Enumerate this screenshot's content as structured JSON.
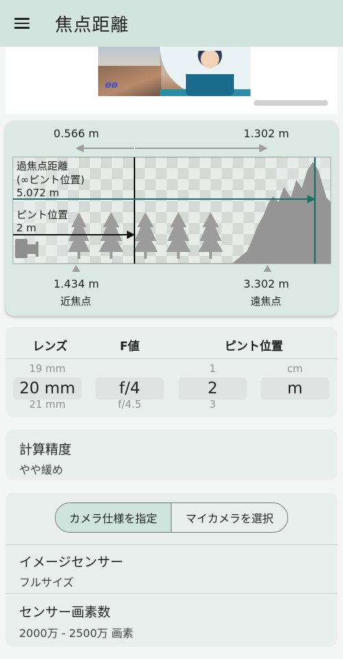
{
  "app_bar": {
    "title": "焦点距離",
    "menu_icon": "hamburger-menu-icon"
  },
  "ad": {
    "logo_text": "ΘΘ"
  },
  "dof": {
    "dof_near_label": "0.566 m",
    "dof_far_label": "1.302 m",
    "hyperfocal_title_line1": "過焦点距離",
    "hyperfocal_title_line2": "(∞ピント位置)",
    "hyperfocal_value": "5.072 m",
    "focus_title": "ピント位置",
    "focus_value": "2 m",
    "near_point_value": "1.434 m",
    "near_point_label": "近焦点",
    "far_point_value": "3.302 m",
    "far_point_label": "遠焦点",
    "colors": {
      "teal": "#1f6e63",
      "arrow_gray": "#9a9f9d",
      "tree_gray": "#9c9c9c",
      "black": "#111111"
    }
  },
  "picker": {
    "headers": {
      "lens": "レンズ",
      "fnum": "F値",
      "focus": "ピント位置"
    },
    "lens": {
      "prev": "19 mm",
      "selected": "20 mm",
      "next": "21 mm"
    },
    "fnum": {
      "prev": "",
      "selected": "f/4",
      "next": "f/4.5"
    },
    "focus": {
      "prev": "1",
      "selected": "2",
      "next": "3"
    },
    "unit": {
      "prev": "cm",
      "selected": "m",
      "next": ""
    }
  },
  "precision": {
    "title": "計算精度",
    "value": "やや緩め"
  },
  "camera": {
    "segment_selected": "カメラ仕様を指定",
    "segment_other": "マイカメラを選択",
    "sensor_title": "イメージセンサー",
    "sensor_value": "フルサイズ",
    "pixels_title": "センサー画素数",
    "pixels_value": "2000万 - 2500万 画素"
  }
}
